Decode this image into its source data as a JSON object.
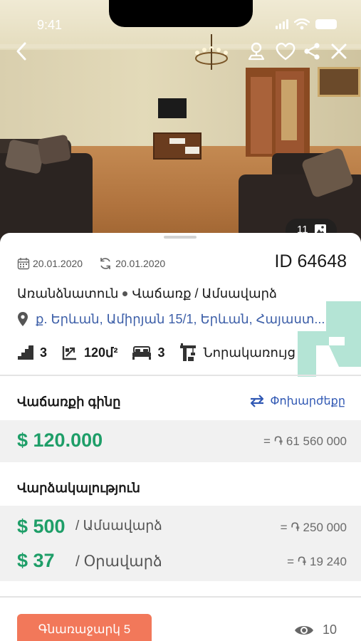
{
  "status_bar": {
    "time": "9:41"
  },
  "gallery": {
    "photo_count": "11"
  },
  "listing": {
    "created_date": "20.01.2020",
    "updated_date": "20.01.2020",
    "id_label": "ID 64648",
    "property_type": "Առանձնատուն",
    "deal_type": "Վաճառք / Ամսավարձ",
    "address": "ք. Երևան, Ամիրյան 15/1, Երևան, Հայաստ..."
  },
  "features": {
    "floors": "3",
    "area": "120մ²",
    "bedrooms": "3",
    "building_type": "Նորակառույց"
  },
  "sale": {
    "title": "Վաճառքի գինը",
    "convert_label": "Փոխարժեքը",
    "price_usd": "$ 120.000",
    "price_amd": "= ֏ 61 560 000"
  },
  "rent": {
    "title": "Վարձակալություն",
    "monthly_usd": "$ 500",
    "monthly_period": "/ Ամսավարձ",
    "monthly_amd": "= ֏ 250 000",
    "daily_usd": "$ 37",
    "daily_period": "/ Օրավարձ",
    "daily_amd": "= ֏ 19 240"
  },
  "footer": {
    "offer_button": "Գնառաջարկ 5",
    "views_count": "10"
  },
  "colors": {
    "price_green": "#1e9e68",
    "link_blue": "#2f57b3",
    "offer_orange": "#f2785a"
  }
}
